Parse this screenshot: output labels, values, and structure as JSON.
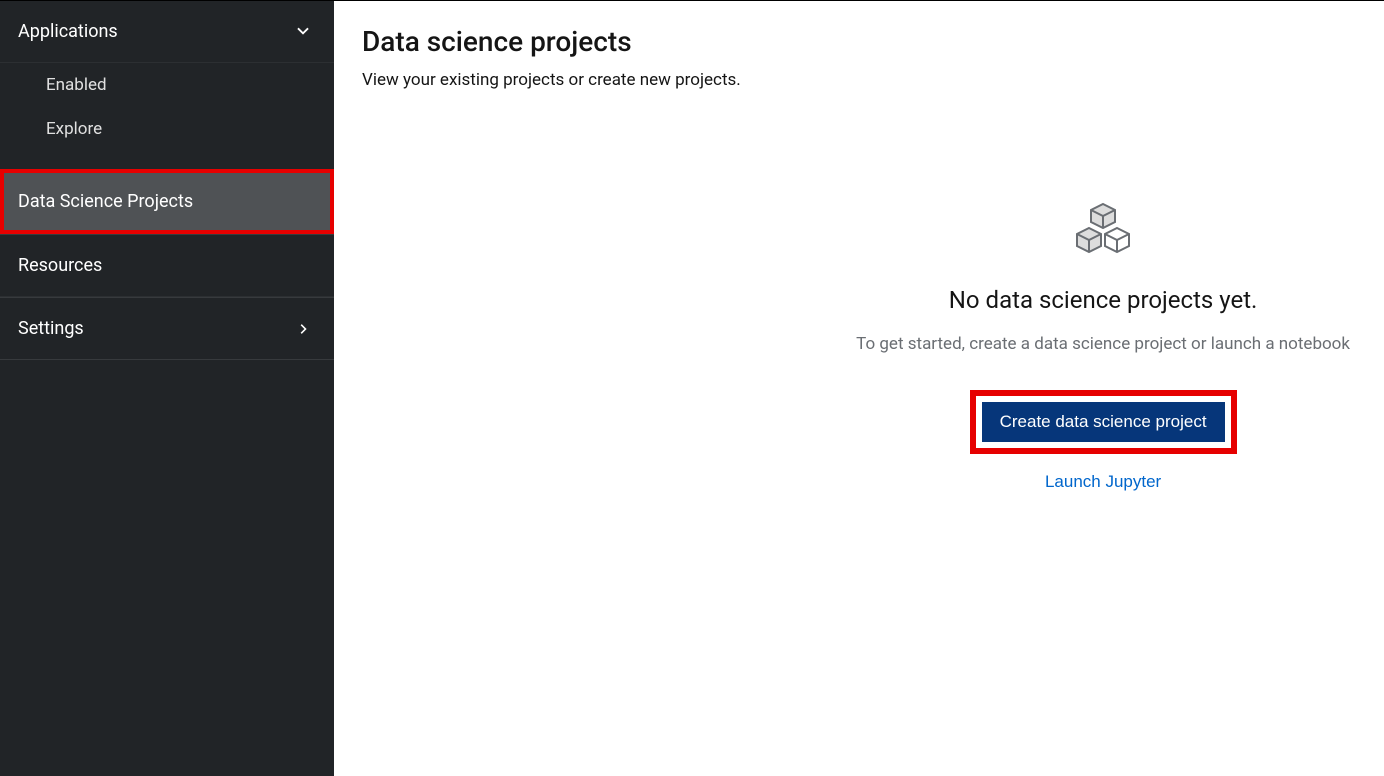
{
  "sidebar": {
    "applications": {
      "label": "Applications",
      "subitems": [
        "Enabled",
        "Explore"
      ]
    },
    "data_science_projects": "Data Science Projects",
    "resources": "Resources",
    "settings": "Settings"
  },
  "main": {
    "title": "Data science projects",
    "subtitle": "View your existing projects or create new projects."
  },
  "empty": {
    "title": "No data science projects yet.",
    "description": "To get started, create a data science project or launch a notebook",
    "create_button": "Create data science project",
    "launch_link": "Launch Jupyter"
  }
}
